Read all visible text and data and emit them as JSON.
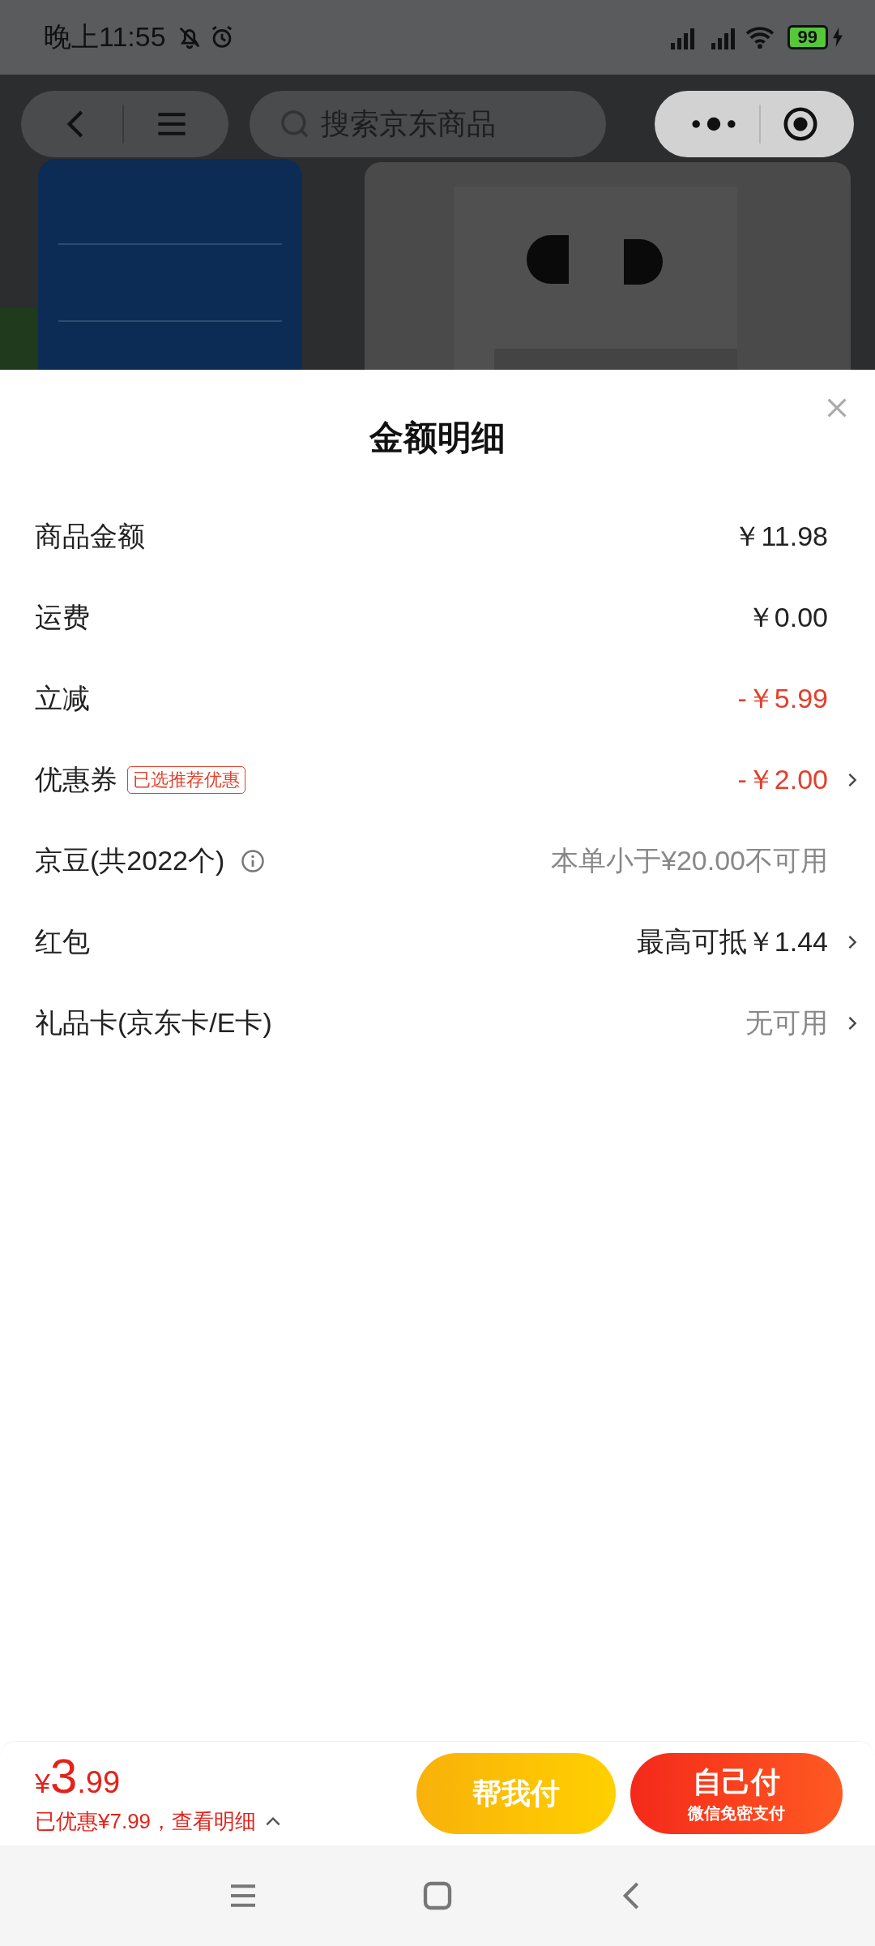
{
  "status_bar": {
    "time": "晚上11:55",
    "battery": "99"
  },
  "top_bar": {
    "search": {
      "placeholder": "搜索京东商品"
    }
  },
  "sheet": {
    "title": "金额明细",
    "rows": [
      {
        "label": "商品金额",
        "value": "￥11.98",
        "kind": "plain",
        "arrow": false
      },
      {
        "label": "运费",
        "value": "￥0.00",
        "kind": "plain",
        "arrow": false
      },
      {
        "label": "立减",
        "value": "-￥5.99",
        "kind": "discount",
        "arrow": false
      },
      {
        "label": "优惠券",
        "badge": "已选推荐优惠",
        "value": "-￥2.00",
        "kind": "discount",
        "arrow": true
      },
      {
        "label": "京豆(共2022个)",
        "info": true,
        "value": "本单小于¥20.00不可用",
        "kind": "muted",
        "arrow": false
      },
      {
        "label": "红包",
        "value": "最高可抵￥1.44",
        "kind": "plain",
        "arrow": true
      },
      {
        "label": "礼品卡(京东卡/E卡)",
        "value": "无可用",
        "kind": "muted",
        "arrow": true
      }
    ]
  },
  "footer": {
    "currency": "¥",
    "price_integer": "3",
    "price_decimal": ".99",
    "savings": "已优惠¥7.99，查看明细",
    "buttons": [
      {
        "label": "帮我付",
        "kind": "friend"
      },
      {
        "label": "自己付",
        "sublabel": "微信免密支付",
        "kind": "self"
      }
    ]
  }
}
